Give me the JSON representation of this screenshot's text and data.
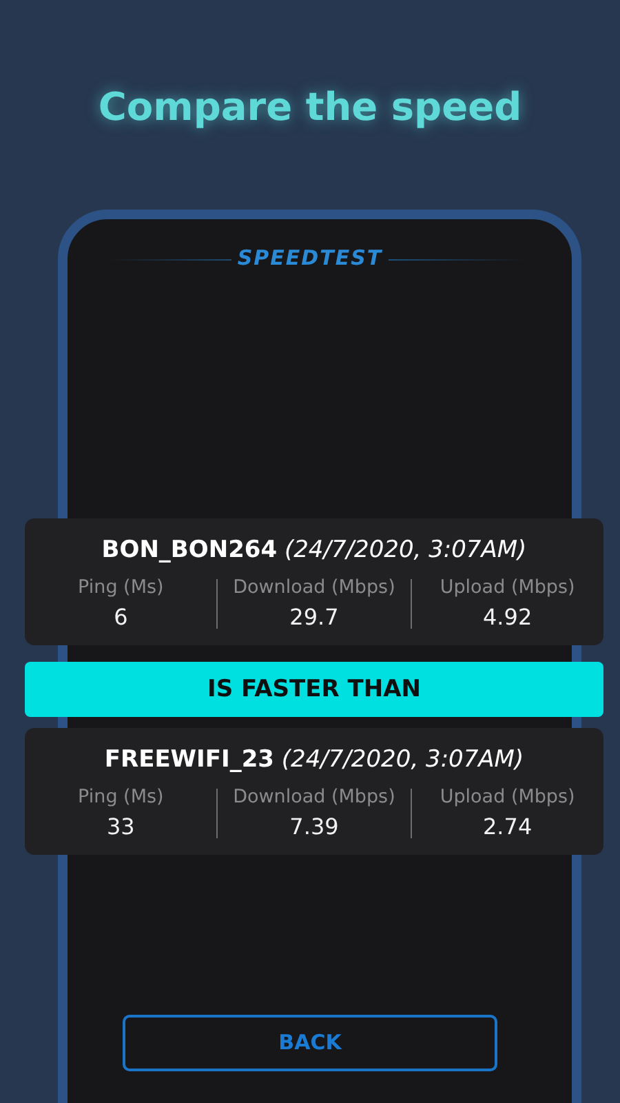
{
  "title": "Compare the speed",
  "logo": "SPEEDTEST",
  "results": [
    {
      "network": "BON_BON264",
      "date": "(24/7/2020, 3:07AM)",
      "metrics": [
        {
          "label": "Ping (Ms)",
          "value": "6"
        },
        {
          "label": "Download (Mbps)",
          "value": "29.7"
        },
        {
          "label": "Upload (Mbps)",
          "value": "4.92"
        }
      ]
    },
    {
      "network": "FREEWIFI_23",
      "date": "(24/7/2020, 3:07AM)",
      "metrics": [
        {
          "label": "Ping (Ms)",
          "value": "33"
        },
        {
          "label": "Download (Mbps)",
          "value": "7.39"
        },
        {
          "label": "Upload (Mbps)",
          "value": "2.74"
        }
      ]
    }
  ],
  "verdict": "IS FASTER THAN",
  "back_button": "BACK"
}
